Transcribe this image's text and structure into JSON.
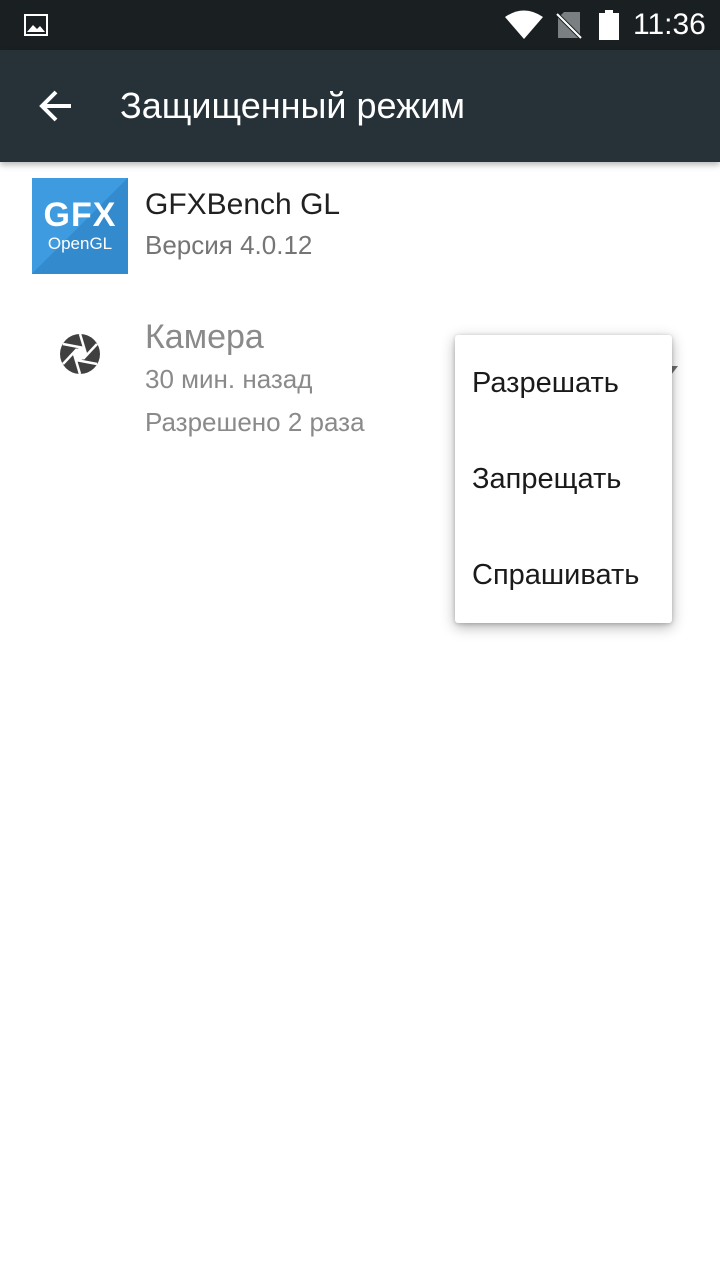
{
  "status_bar": {
    "time": "11:36",
    "icons": [
      "image-notification-icon",
      "wifi-icon",
      "no-sim-icon",
      "battery-icon"
    ]
  },
  "toolbar": {
    "title": "Защищенный режим",
    "back_icon": "arrow-back-icon"
  },
  "app": {
    "icon_line1": "GFX",
    "icon_line2": "OpenGL",
    "name": "GFXBench GL",
    "version": "Версия 4.0.12"
  },
  "permission": {
    "icon": "camera-icon",
    "title": "Камера",
    "last_used": "30 мин. назад",
    "count": "Разрешено 2 раза"
  },
  "popup_menu": {
    "items": [
      "Разрешать",
      "Запрещать",
      "Спрашивать"
    ]
  },
  "colors": {
    "status_bar": "#1a1f22",
    "toolbar": "#263238",
    "app_icon": "#3e9be0",
    "secondary_text": "#8a8a8a"
  }
}
